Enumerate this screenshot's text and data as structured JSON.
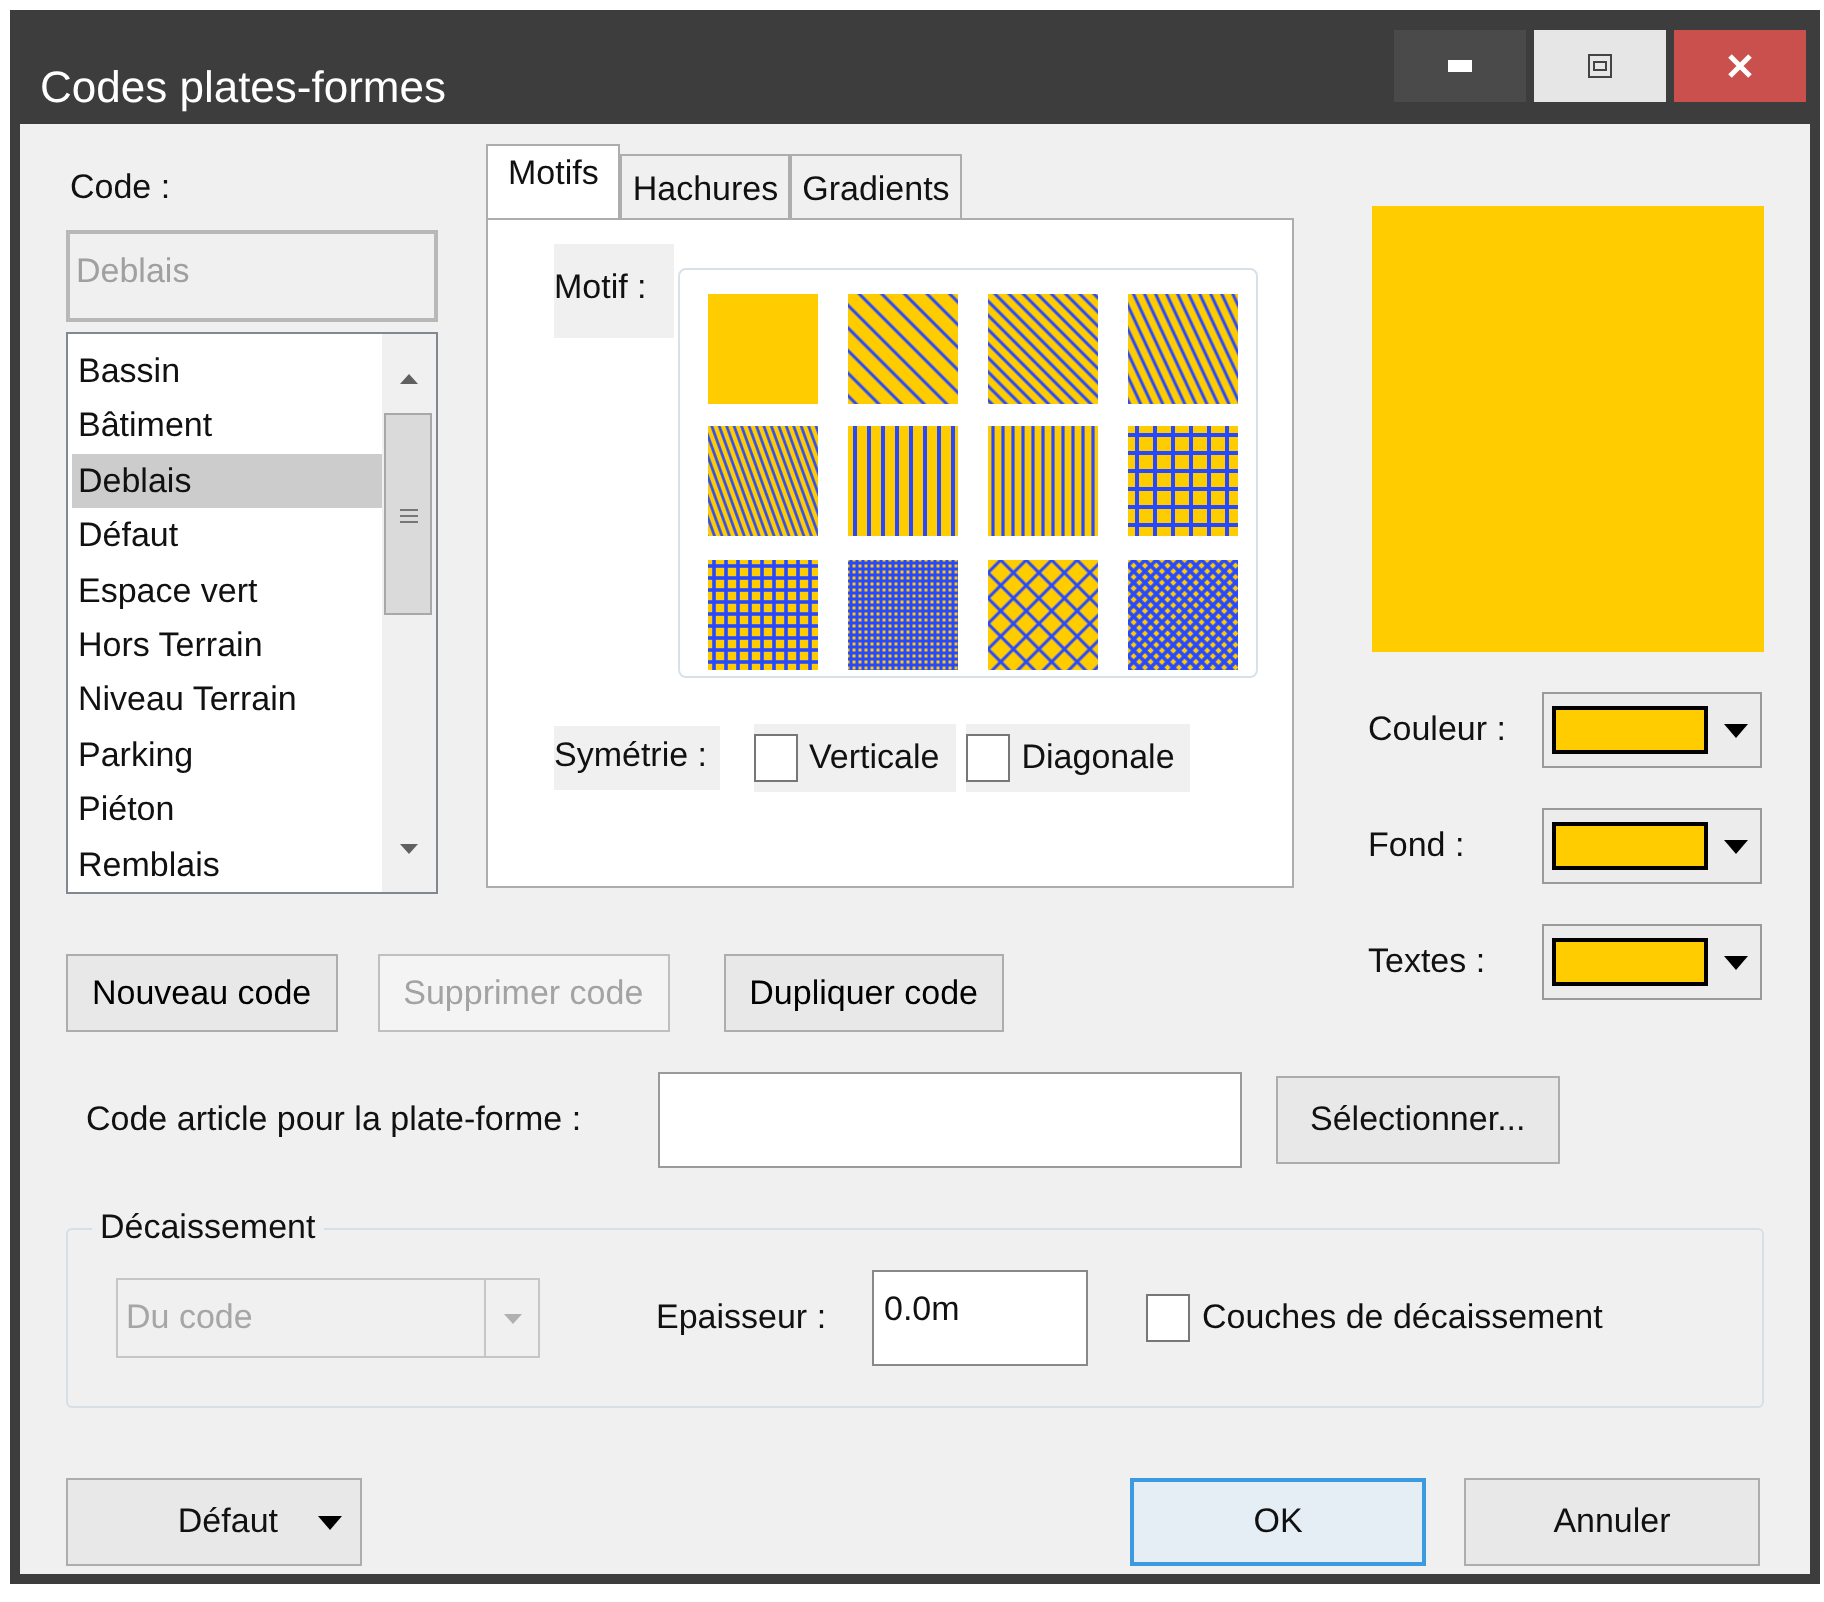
{
  "window": {
    "title": "Codes plates-formes",
    "controls": [
      {
        "kind": "minimize"
      },
      {
        "kind": "restore"
      },
      {
        "kind": "close"
      }
    ]
  },
  "code": {
    "label": "Code :",
    "value": "Deblais",
    "disabled": true
  },
  "code_list": [
    {
      "label": "Bassin",
      "selected": false
    },
    {
      "label": "Bâtiment",
      "selected": false
    },
    {
      "label": "Deblais",
      "selected": true
    },
    {
      "label": "Défaut",
      "selected": false
    },
    {
      "label": "Espace vert",
      "selected": false
    },
    {
      "label": "Hors Terrain",
      "selected": false
    },
    {
      "label": "Niveau Terrain",
      "selected": false
    },
    {
      "label": "Parking",
      "selected": false
    },
    {
      "label": "Piéton",
      "selected": false
    },
    {
      "label": "Remblais",
      "selected": false
    }
  ],
  "tabs": [
    {
      "label": "Motifs",
      "selected": true
    },
    {
      "label": "Hachures",
      "selected": false
    },
    {
      "label": "Gradients",
      "selected": false
    }
  ],
  "motif": {
    "label": "Motif :",
    "patterns": [
      {
        "kind": "solid"
      },
      {
        "kind": "diag-wide"
      },
      {
        "kind": "diag-dense"
      },
      {
        "kind": "diag-steep"
      },
      {
        "kind": "diag-fine"
      },
      {
        "kind": "vert-wide"
      },
      {
        "kind": "vert-dense"
      },
      {
        "kind": "grid-wide"
      },
      {
        "kind": "grid-dense"
      },
      {
        "kind": "grid-fine"
      },
      {
        "kind": "diamond"
      },
      {
        "kind": "checker"
      }
    ]
  },
  "symmetry": {
    "label": "Symétrie :",
    "options": [
      {
        "label": "Verticale",
        "checked": false
      },
      {
        "label": "Diagonale",
        "checked": false
      }
    ]
  },
  "preview": {
    "color": "#ffcc00"
  },
  "color_pickers": [
    {
      "label": "Couleur :",
      "color": "#ffcc00"
    },
    {
      "label": "Fond :",
      "color": "#ffcc00"
    },
    {
      "label": "Textes :",
      "color": "#ffcc00"
    }
  ],
  "code_buttons": [
    {
      "label": "Nouveau code",
      "disabled": false
    },
    {
      "label": "Supprimer code",
      "disabled": true
    },
    {
      "label": "Dupliquer code",
      "disabled": false
    }
  ],
  "article": {
    "label": "Code article pour la plate-forme :",
    "button": "Sélectionner..."
  },
  "decaissement": {
    "title": "Décaissement",
    "mode": {
      "value": "Du code",
      "disabled": true
    },
    "thickness_label": "Epaisseur :",
    "thickness": "0.0m",
    "layers": {
      "label": "Couches de décaissement",
      "checked": false
    }
  },
  "footer": {
    "default_button": "Défaut",
    "ok": "OK",
    "cancel": "Annuler"
  }
}
